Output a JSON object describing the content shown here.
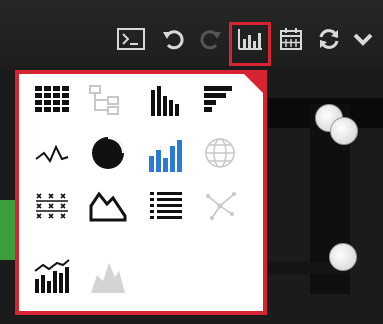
{
  "toolbar": {
    "icons": [
      {
        "name": "terminal-icon",
        "active": false
      },
      {
        "name": "undo-icon",
        "active": false
      },
      {
        "name": "redo-icon",
        "active": false
      },
      {
        "name": "bar-chart-icon",
        "active": true
      },
      {
        "name": "calendar-icon",
        "active": false
      },
      {
        "name": "refresh-icon",
        "active": false
      },
      {
        "name": "chevron-down-icon",
        "active": false
      }
    ]
  },
  "chart_types": [
    {
      "name": "table-icon",
      "enabled": true
    },
    {
      "name": "tree-icon",
      "enabled": false
    },
    {
      "name": "column-chart-icon",
      "enabled": true
    },
    {
      "name": "horizontal-bar-chart-icon",
      "enabled": true
    },
    {
      "name": "line-chart-icon",
      "enabled": true
    },
    {
      "name": "pie-chart-icon",
      "enabled": true
    },
    {
      "name": "blue-column-chart-icon",
      "enabled": true
    },
    {
      "name": "globe-icon",
      "enabled": false
    },
    {
      "name": "matrix-icon",
      "enabled": true
    },
    {
      "name": "area-chart-icon",
      "enabled": true
    },
    {
      "name": "list-icon",
      "enabled": true
    },
    {
      "name": "network-icon",
      "enabled": false
    },
    {
      "name": "combo-chart-icon",
      "enabled": true
    },
    {
      "name": "mountain-chart-icon",
      "enabled": false
    }
  ],
  "colors": {
    "highlight": "#d62432",
    "accent_blue": "#2b7bd6",
    "icon_black": "#111111",
    "icon_disabled": "#c8c8c8"
  }
}
